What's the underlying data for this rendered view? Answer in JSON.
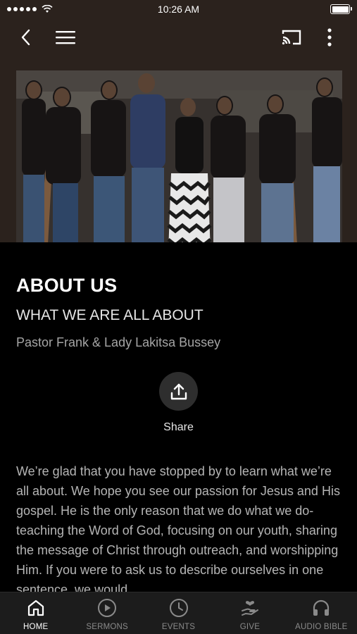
{
  "status_bar": {
    "time": "10:26 AM"
  },
  "navbar": {
    "back_icon": "chevron-left-icon",
    "menu_icon": "hamburger-icon",
    "cast_icon": "cast-icon",
    "more_icon": "more-vertical-icon"
  },
  "hero": {
    "image_alt": "Group photo of church members posing on stage"
  },
  "page": {
    "title": "ABOUT US",
    "subtitle": "WHAT WE ARE ALL ABOUT",
    "byline": "Pastor Frank & Lady Lakitsa Bussey"
  },
  "share": {
    "label": "Share",
    "icon": "share-icon"
  },
  "body": {
    "text": "We’re glad that you have stopped by to learn what we’re all about. We hope you see our passion for Jesus and His gospel. He is the only reason that we do what we do-teaching the Word of God, focusing on our youth, sharing the message of Christ through outreach, and worshipping Him. If you were to ask us to describe ourselves in one sentence, we would"
  },
  "tabs": [
    {
      "label": "HOME",
      "icon": "home-icon",
      "active": true
    },
    {
      "label": "SERMONS",
      "icon": "play-circle-icon",
      "active": false
    },
    {
      "label": "EVENTS",
      "icon": "clock-icon",
      "active": false
    },
    {
      "label": "GIVE",
      "icon": "give-hand-icon",
      "active": false
    },
    {
      "label": "AUDIO BIBLE",
      "icon": "headphones-icon",
      "active": false
    }
  ],
  "colors": {
    "header_bg": "#2b221d",
    "background": "#000000",
    "tabbar_bg": "#1c1c1c",
    "text_secondary": "#a5a5a5"
  }
}
